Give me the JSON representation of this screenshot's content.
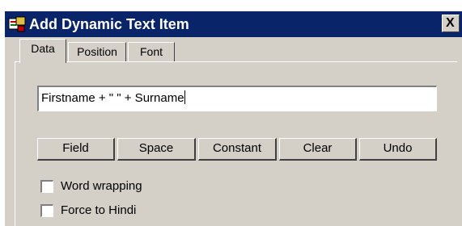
{
  "window": {
    "title": "Add Dynamic Text Item",
    "close_glyph": "X",
    "icon": "app-icon"
  },
  "tabs": [
    {
      "label": "Data",
      "active": true
    },
    {
      "label": "Position",
      "active": false
    },
    {
      "label": "Font",
      "active": false
    }
  ],
  "expression": {
    "value": "Firstname + \" \" + Surname"
  },
  "buttons": {
    "field": "Field",
    "space": "Space",
    "constant": "Constant",
    "clear": "Clear",
    "undo": "Undo"
  },
  "options": {
    "word_wrapping": {
      "label": "Word wrapping",
      "checked": false
    },
    "force_hindi": {
      "label": "Force to Hindi",
      "checked": false
    }
  },
  "colors": {
    "titlebar": "#0a246a",
    "dialog_face": "#d4d0c8"
  }
}
